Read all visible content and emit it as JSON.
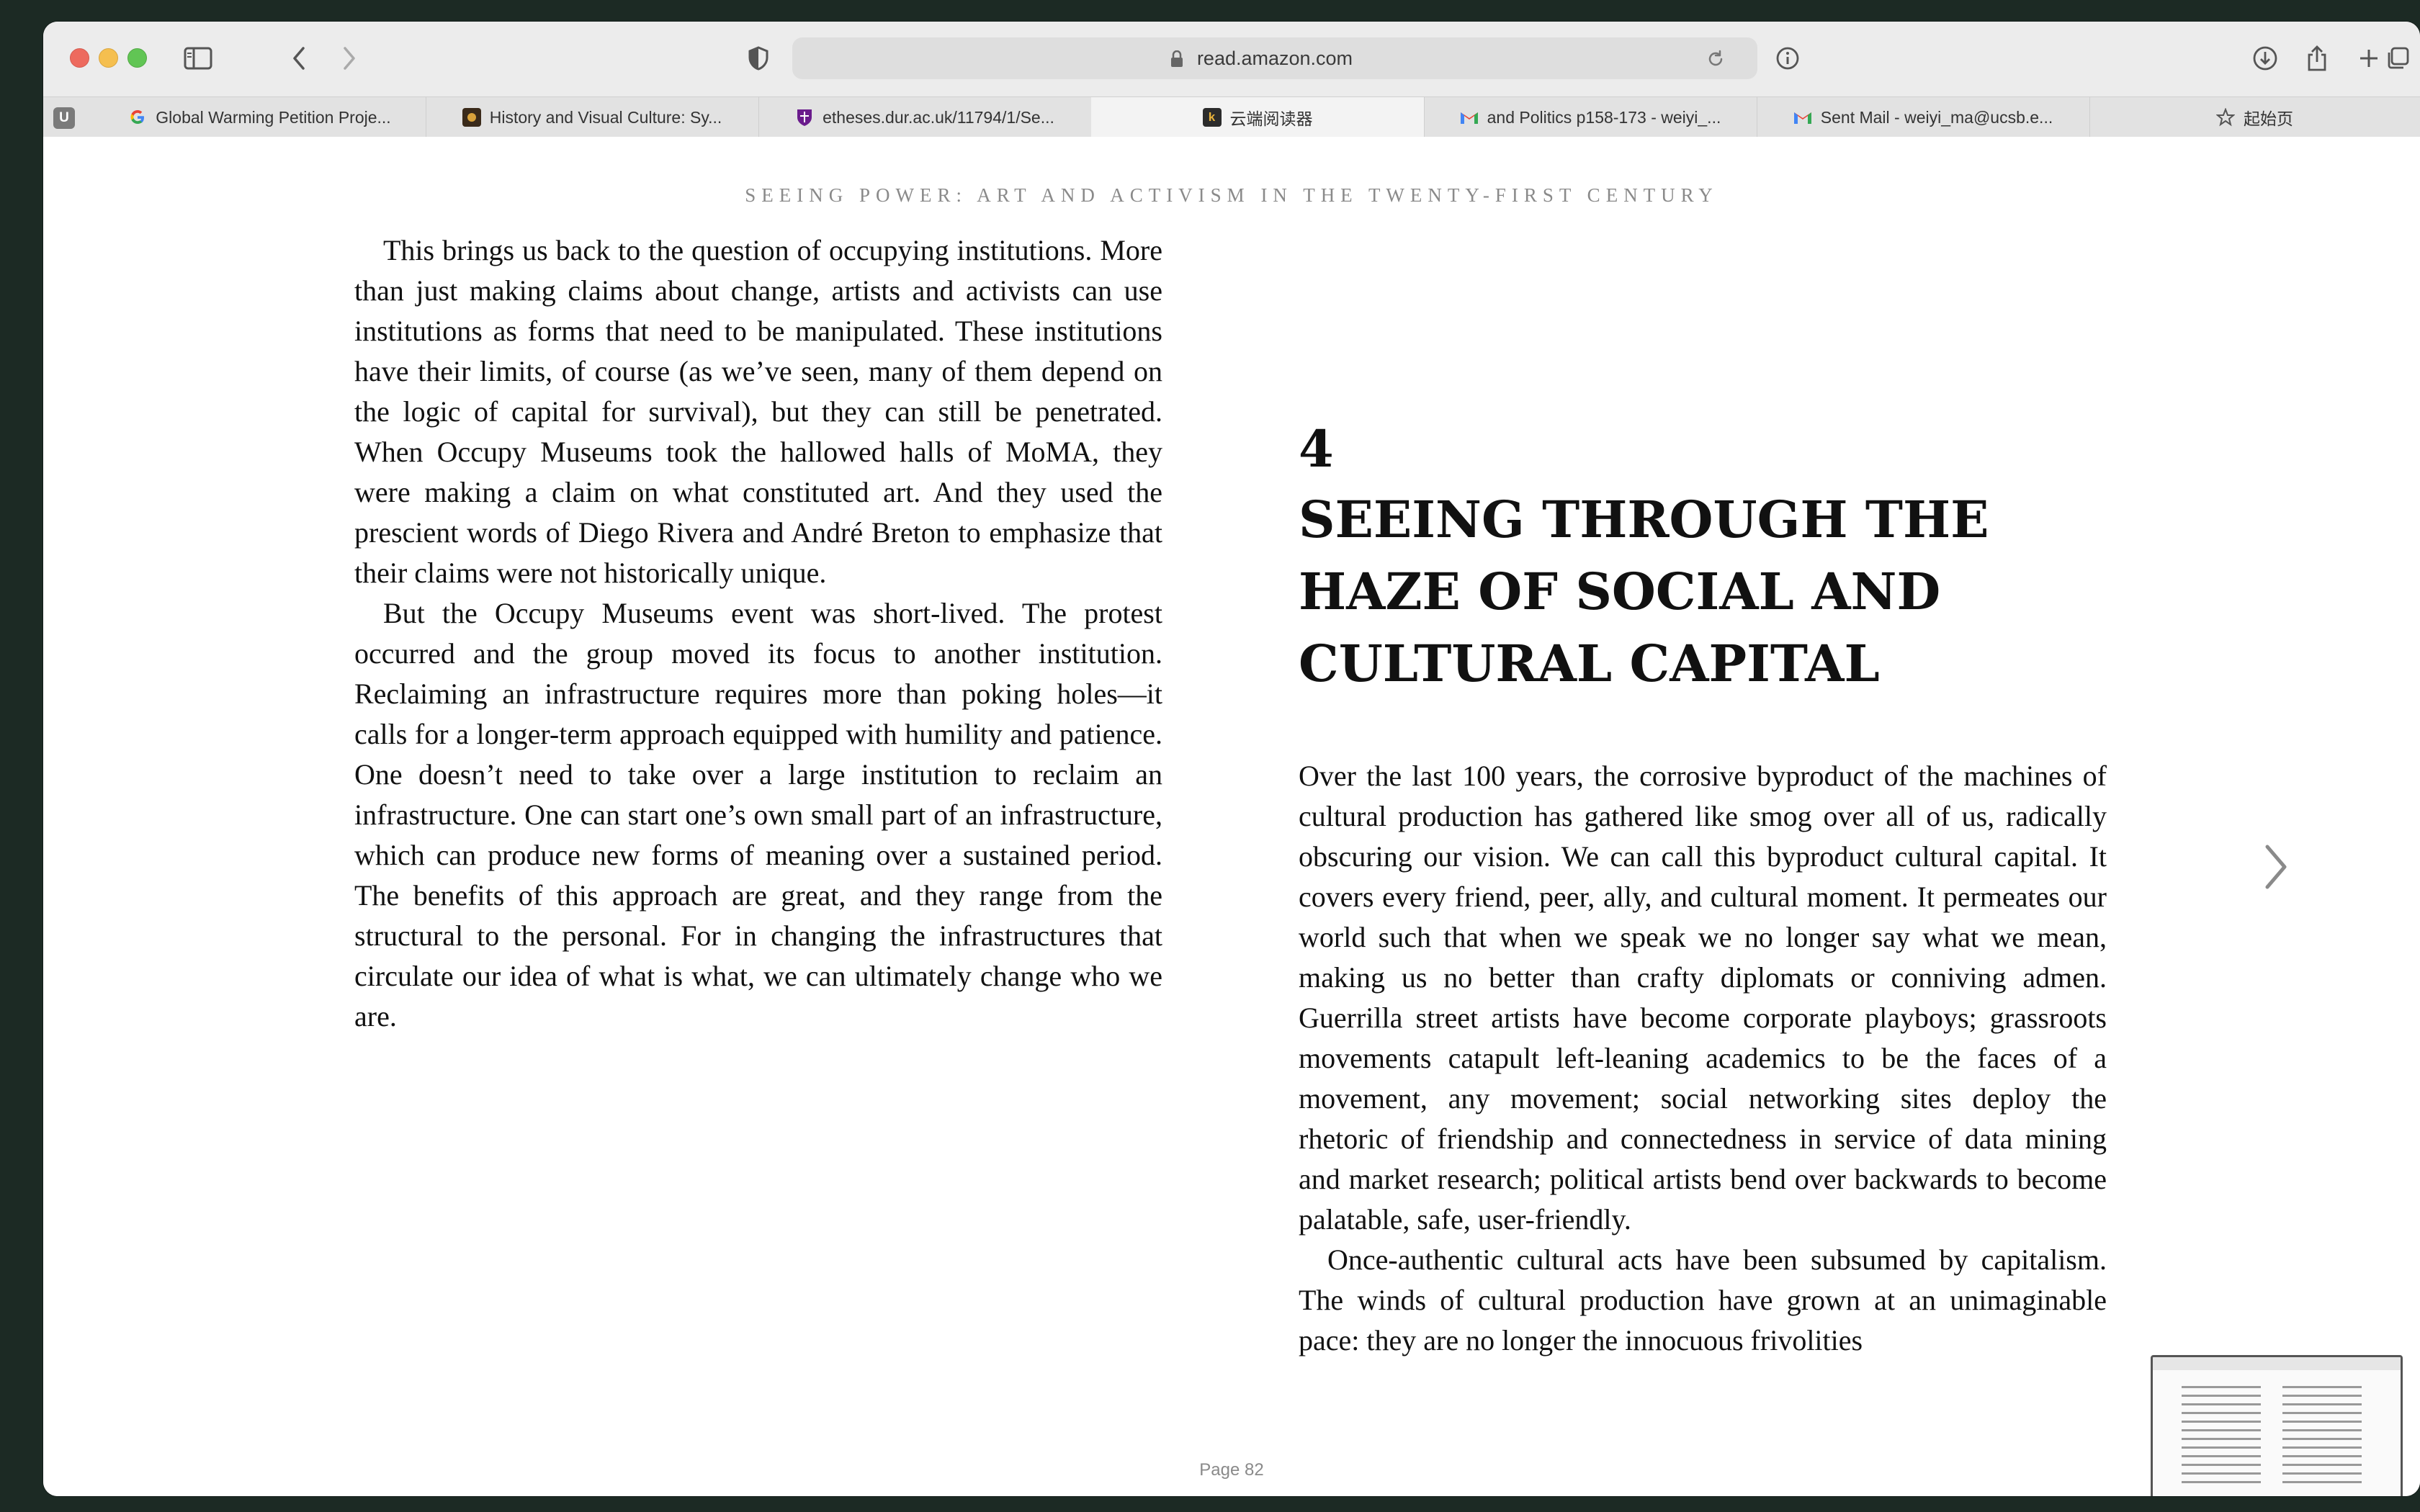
{
  "browser": {
    "url": "read.amazon.com",
    "pinned_tab": "U",
    "tabs": [
      {
        "label": "Global Warming Petition Proje...",
        "favicon": "google-icon",
        "active": false
      },
      {
        "label": "History and Visual Culture: Sy...",
        "favicon": "site-icon",
        "active": false
      },
      {
        "label": "etheses.dur.ac.uk/11794/1/Se...",
        "favicon": "durham-crest-icon",
        "active": false
      },
      {
        "label": "云端阅读器",
        "favicon": "kindle-icon",
        "active": true
      },
      {
        "label": "and Politics p158-173 - weiyi_...",
        "favicon": "gmail-icon",
        "active": false
      },
      {
        "label": "Sent Mail - weiyi_ma@ucsb.e...",
        "favicon": "gmail-icon",
        "active": false
      },
      {
        "label": "起始页",
        "favicon": "star-icon",
        "active": false
      }
    ]
  },
  "reader": {
    "book_title": "SEEING POWER: ART AND ACTIVISM IN THE TWENTY-FIRST CENTURY",
    "left_page": {
      "paragraphs": [
        "This brings us back to the question of occupying institutions. More than just making claims about change, artists and activists can use institutions as forms that need to be manipulated. These institutions have their limits, of course (as we’ve seen, many of them depend on the logic of capital for survival), but they can still be penetrated. When Occupy Museums took the hallowed halls of MoMA, they were making a claim on what constituted art. And they used the prescient words of Diego Rivera and André Breton to emphasize that their claims were not historically unique.",
        "But the Occupy Museums event was short-lived. The protest occurred and the group moved its focus to another institution. Reclaiming an infrastructure requires more than poking holes—it calls for a longer-term approach equipped with humility and patience. One doesn’t need to take over a large institution to reclaim an infrastructure. One can start one’s own small part of an infrastructure, which can produce new forms of meaning over a sustained period. The benefits of this approach are great, and they range from the structural to the personal. For in changing the infrastructures that circulate our idea of what is what, we can ultimately change who we are."
      ]
    },
    "right_page": {
      "chapter_number": "4",
      "chapter_title": "SEEING THROUGH THE HAZE OF SOCIAL AND CULTURAL CAPITAL",
      "paragraphs": [
        "Over the last 100 years, the corrosive byproduct of the machines of cultural production has gathered like smog over all of us, radically obscuring our vision. We can call this byproduct cultural capital. It covers every friend, peer, ally, and cultural moment. It permeates our world such that when we speak we no longer say what we mean, making us no better than crafty diplomats or conniving admen. Guerrilla street artists have become corporate playboys; grassroots movements catapult left-leaning academics to be the faces of a movement, any movement; social networking sites deploy the rhetoric of friendship and connectedness in service of data mining and market research; political artists bend over backwards to become palatable, safe, user-friendly.",
        "Once-authentic cultural acts have been subsumed by capitalism. The winds of cultural production have grown at an unimaginable pace: they are no longer the innocuous frivolities"
      ]
    },
    "page_label": "Page 82"
  }
}
